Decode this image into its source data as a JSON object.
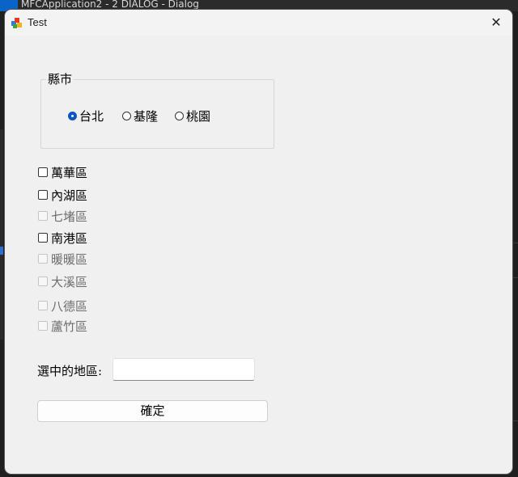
{
  "background": {
    "partial_title": "MFCApplication2 - 2 DIALOG - Dialog"
  },
  "window": {
    "title": "Test",
    "close_glyph": "✕"
  },
  "group": {
    "label": "縣市",
    "radios": [
      {
        "label": "台北",
        "checked": true
      },
      {
        "label": "基隆",
        "checked": false
      },
      {
        "label": "桃園",
        "checked": false
      }
    ]
  },
  "checkboxes": [
    {
      "label": "萬華區",
      "enabled": true,
      "checked": false
    },
    {
      "label": "內湖區",
      "enabled": true,
      "checked": false
    },
    {
      "label": "七堵區",
      "enabled": false,
      "checked": false
    },
    {
      "label": "南港區",
      "enabled": true,
      "checked": false
    },
    {
      "label": "暖暖區",
      "enabled": false,
      "checked": false
    },
    {
      "label": "大溪區",
      "enabled": false,
      "checked": false
    },
    {
      "label": "八德區",
      "enabled": false,
      "checked": false
    },
    {
      "label": "蘆竹區",
      "enabled": false,
      "checked": false
    }
  ],
  "selection": {
    "label": "選中的地區:",
    "value": ""
  },
  "ok_button": {
    "label": "確定"
  },
  "colors": {
    "radio_accent": "#0a56c2",
    "window_bg": "#f0f0f0"
  },
  "icons": {
    "app": "mfc-app-icon",
    "close": "close-icon"
  }
}
